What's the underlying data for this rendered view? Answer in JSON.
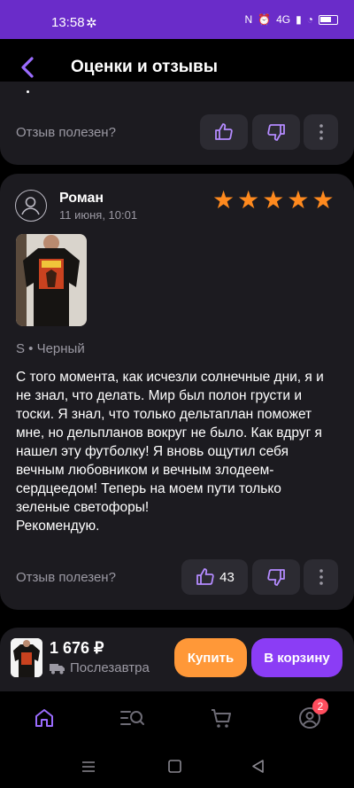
{
  "status_bar": {
    "time": "13:58",
    "network": "4G",
    "battery": "58%"
  },
  "header": {
    "title": "Оценки и отзывы"
  },
  "previous_review": {
    "helpful_label": "Отзыв полезен?"
  },
  "review": {
    "author": "Роман",
    "date": "11 июня, 10:01",
    "rating": 5,
    "variant": "S • Черный",
    "text": "С того момента, как исчезли солнечные дни, я и не знал, что делать. Мир был полон грусти и тоски. Я знал, что только дельтаплан поможет мне, но дельпланов вокруг не было. Как вдруг я нашел эту футболку! Я вновь ощутил себя вечным любовником и вечным злодеем-сердцеедом! Теперь на моем пути только зеленые светофоры!\nРекомендую.",
    "helpful_label": "Отзыв полезен?",
    "likes": "43"
  },
  "buy_bar": {
    "price": "1 676 ₽",
    "delivery": "Послезавтра",
    "buy_label": "Купить",
    "cart_label": "В корзину"
  },
  "tabbar": {
    "profile_badge": "2"
  },
  "colors": {
    "accent": "#8b3df5",
    "star": "#ff8a1e",
    "buy": "#ff9838",
    "card": "#1c1b20"
  },
  "icons": [
    "chevron-left-icon",
    "thumbs-up-icon",
    "thumbs-down-icon",
    "more-vertical-icon",
    "user-icon",
    "star-icon",
    "truck-icon",
    "home-icon",
    "catalog-search-icon",
    "cart-icon",
    "profile-icon"
  ]
}
